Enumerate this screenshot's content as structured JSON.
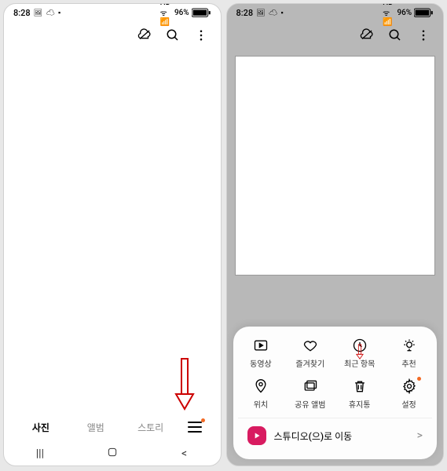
{
  "status": {
    "time": "8:28",
    "icons_left": "🖼 ☁ ▪",
    "network": "HD ᯤ 📶",
    "battery": "96%"
  },
  "tabs": {
    "photos": "사진",
    "albums": "앨범",
    "stories": "스토리"
  },
  "menu": {
    "videos": "동영상",
    "favorites": "즐겨찾기",
    "recent": "최근 항목",
    "suggested": "추천",
    "location": "위치",
    "shared_albums": "공유 앨범",
    "trash": "휴지통",
    "settings": "설정"
  },
  "studio": {
    "label": "스튜디오(으)로 이동"
  }
}
